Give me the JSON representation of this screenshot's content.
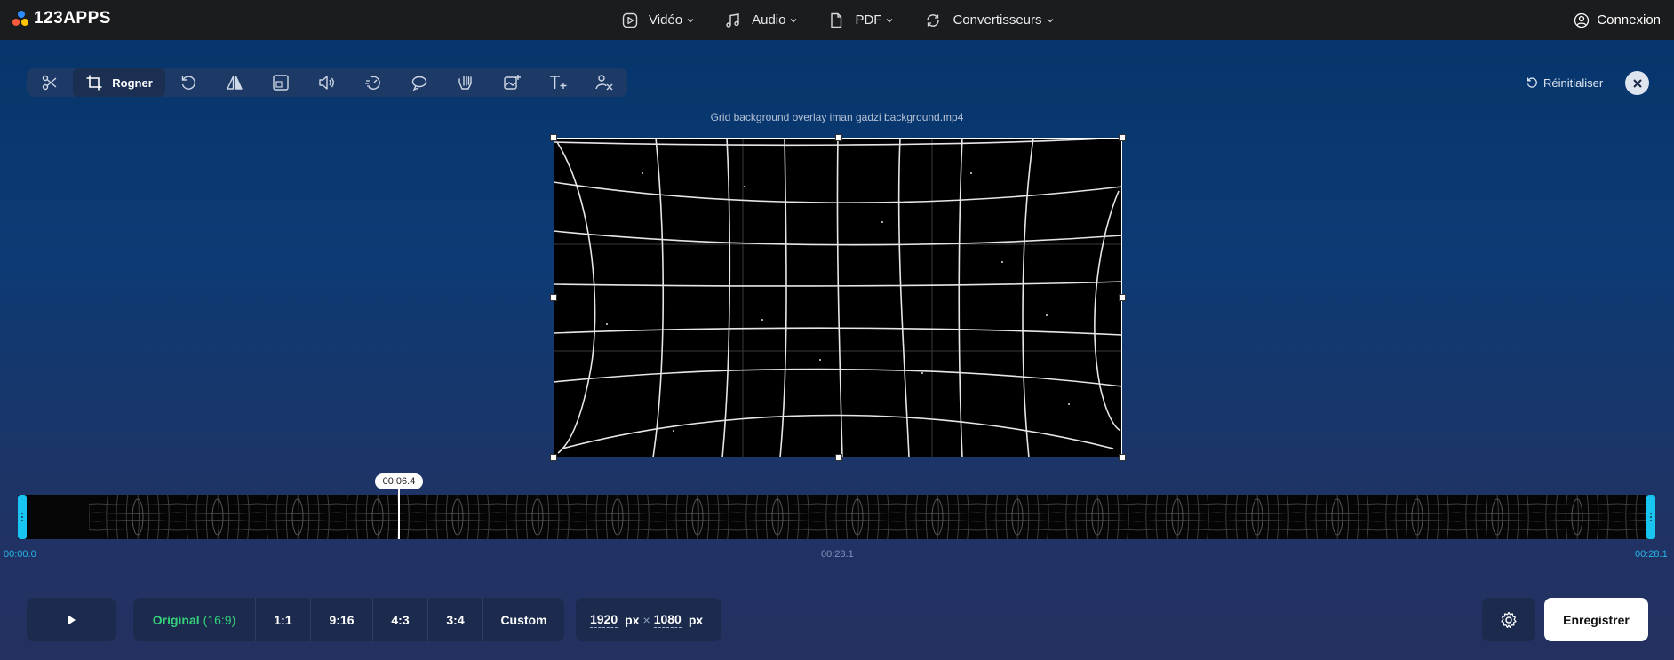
{
  "brand": {
    "name": "123APPS"
  },
  "nav": {
    "items": [
      {
        "label": "Vidéo",
        "icon": "play-circle-icon"
      },
      {
        "label": "Audio",
        "icon": "music-note-icon"
      },
      {
        "label": "PDF",
        "icon": "document-icon"
      },
      {
        "label": "Convertisseurs",
        "icon": "convert-icon"
      }
    ],
    "login_label": "Connexion"
  },
  "toolbar": {
    "active_tool_label": "Rogner",
    "tools": [
      "scissors-icon",
      "crop-icon",
      "rotate-icon",
      "flip-icon",
      "resize-icon",
      "volume-icon",
      "speed-icon",
      "loop-icon",
      "stabilize-icon",
      "add-image-icon",
      "add-text-icon",
      "remove-logo-icon"
    ],
    "reset_label": "Réinitialiser"
  },
  "video": {
    "filename": "Grid background overlay iman gadzi background.mp4"
  },
  "timeline": {
    "current_time": "00:06.4",
    "start_time": "00:00.0",
    "mid_time": "00:28.1",
    "end_time": "00:28.1",
    "playhead_fraction": 0.23
  },
  "aspect": {
    "original_label": "Original",
    "original_ratio": "(16:9)",
    "options": [
      "1:1",
      "9:16",
      "4:3",
      "3:4"
    ],
    "custom_label": "Custom"
  },
  "dimensions": {
    "width": "1920",
    "height": "1080",
    "unit": "px",
    "separator": "×"
  },
  "save_label": "Enregistrer",
  "colors": {
    "accent_green": "#34d27b",
    "accent_cyan": "#18c4f0"
  }
}
